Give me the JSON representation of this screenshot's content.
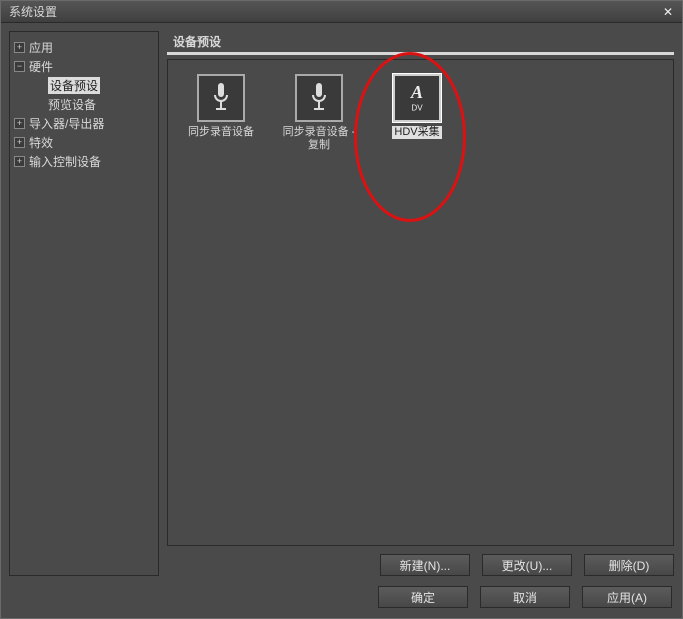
{
  "window": {
    "title": "系统设置"
  },
  "tree": {
    "items": [
      {
        "label": "应用",
        "expander": "+",
        "children": []
      },
      {
        "label": "硬件",
        "expander": "−",
        "children": [
          {
            "label": "设备预设",
            "selected": true
          },
          {
            "label": "预览设备"
          }
        ]
      },
      {
        "label": "导入器/导出器",
        "expander": "+",
        "children": []
      },
      {
        "label": "特效",
        "expander": "+",
        "children": []
      },
      {
        "label": "输入控制设备",
        "expander": "+",
        "children": []
      }
    ]
  },
  "section": {
    "header": "设备预设"
  },
  "presets": [
    {
      "label": "同步录音设备",
      "icon": "mic",
      "selected": false
    },
    {
      "label": "同步录音设备 - 复制",
      "icon": "mic",
      "selected": false
    },
    {
      "label": "HDV采集",
      "icon": "adv",
      "selected": true
    }
  ],
  "buttons": {
    "new": "新建(N)...",
    "change": "更改(U)...",
    "delete": "删除(D)",
    "ok": "确定",
    "cancel": "取消",
    "apply": "应用(A)"
  }
}
